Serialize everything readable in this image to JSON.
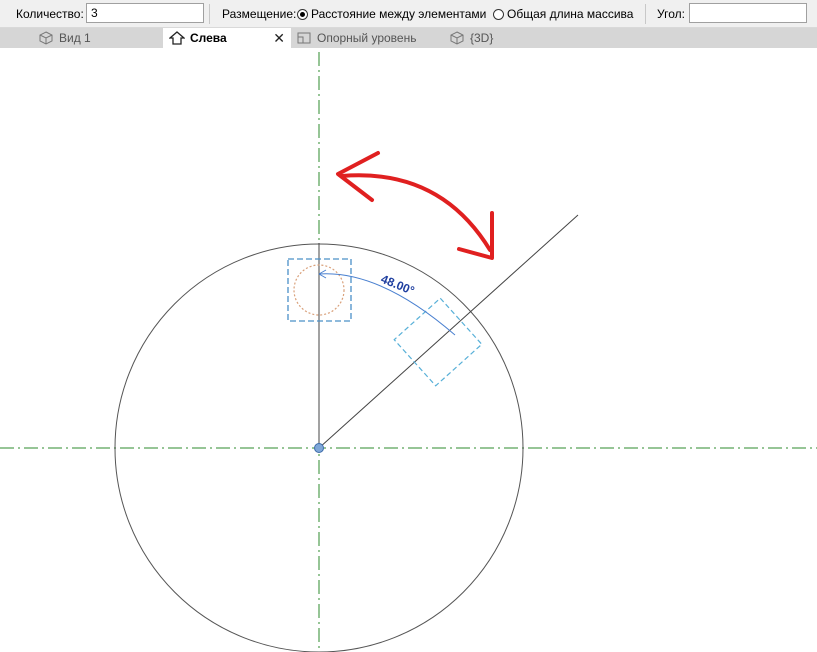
{
  "options_bar": {
    "count_label": "Количество:",
    "count_value": "3",
    "placement_label": "Размещение:",
    "placement_options": [
      {
        "label": "Расстояние между элементами",
        "selected": true
      },
      {
        "label": "Общая длина массива",
        "selected": false
      }
    ],
    "angle_label": "Угол:",
    "angle_value": ""
  },
  "tabs": [
    {
      "label": "Вид 1",
      "icon": "3d-view-icon",
      "active": false
    },
    {
      "label": "Слева",
      "icon": "elevation-icon",
      "active": true,
      "closable": true
    },
    {
      "label": "Опорный уровень",
      "icon": "plan-view-icon",
      "active": false
    },
    {
      "label": "{3D}",
      "icon": "3d-view-icon",
      "active": false
    }
  ],
  "canvas": {
    "angle_dimension": "48.00°",
    "colors": {
      "reference_plane": "#2e8b2e",
      "geometry": "#555555",
      "selection": "#4a90c8",
      "hidden_circle": "#d9a07a",
      "markup_arrow": "#e02020"
    }
  }
}
